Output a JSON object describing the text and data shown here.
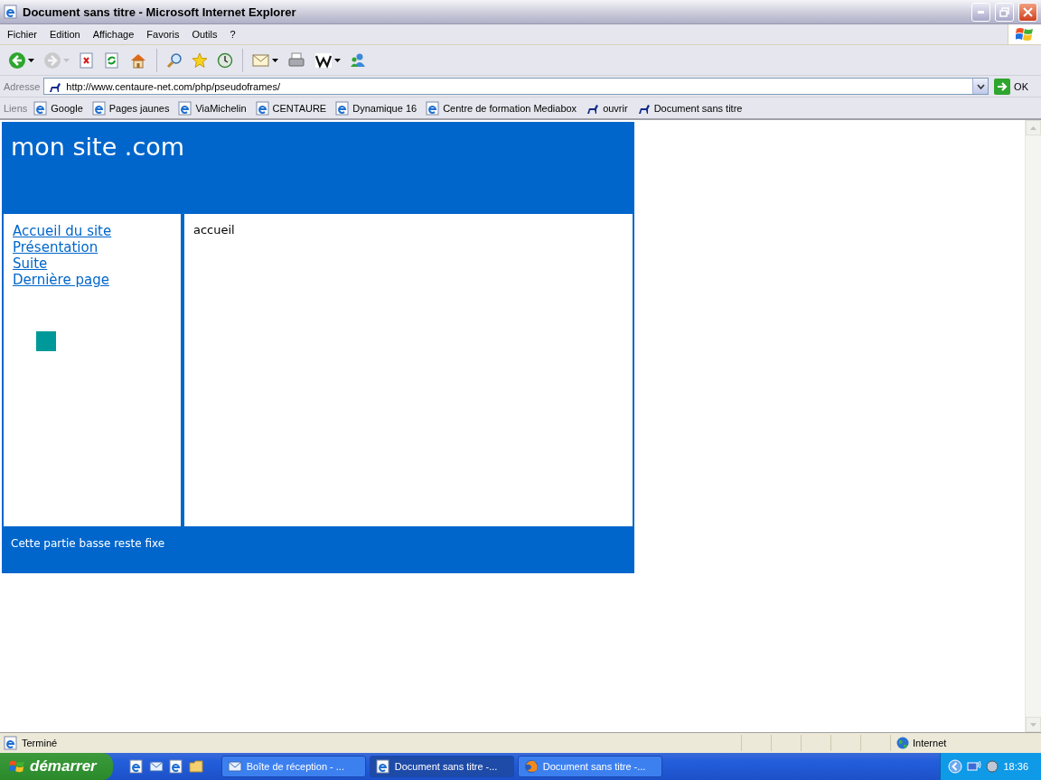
{
  "window": {
    "title": "Document sans titre - Microsoft Internet Explorer"
  },
  "menu": [
    "Fichier",
    "Edition",
    "Affichage",
    "Favoris",
    "Outils",
    "?"
  ],
  "toolbar": [
    {
      "kind": "back",
      "disabled": false,
      "dropdown": true
    },
    {
      "kind": "forward",
      "disabled": true,
      "dropdown": true
    },
    {
      "kind": "stop",
      "disabled": false,
      "dropdown": false
    },
    {
      "kind": "refresh",
      "disabled": false,
      "dropdown": false
    },
    {
      "kind": "home",
      "disabled": false,
      "dropdown": false
    },
    {
      "kind": "search",
      "disabled": false,
      "dropdown": false
    },
    {
      "kind": "favorites",
      "disabled": false,
      "dropdown": false
    },
    {
      "kind": "history",
      "disabled": false,
      "dropdown": false
    },
    {
      "kind": "mail",
      "disabled": false,
      "dropdown": true
    },
    {
      "kind": "print",
      "disabled": false,
      "dropdown": false
    },
    {
      "kind": "word",
      "disabled": false,
      "dropdown": true
    },
    {
      "kind": "messenger",
      "disabled": false,
      "dropdown": false
    }
  ],
  "address_bar": {
    "label": "Adresse",
    "value": "http://www.centaure-net.com/php/pseudoframes/",
    "go": "OK"
  },
  "links_bar": {
    "label": "Liens",
    "links": [
      {
        "label": "Google",
        "kind": "ie"
      },
      {
        "label": "Pages jaunes",
        "kind": "ie"
      },
      {
        "label": "ViaMichelin",
        "kind": "ie"
      },
      {
        "label": "CENTAURE",
        "kind": "ie"
      },
      {
        "label": "Dynamique 16",
        "kind": "ie"
      },
      {
        "label": "Centre de formation Mediabox",
        "kind": "ie"
      },
      {
        "label": "ouvrir",
        "kind": "site"
      },
      {
        "label": "Document sans titre",
        "kind": "site"
      }
    ]
  },
  "page": {
    "site_title": "mon site .com",
    "nav": [
      "Accueil du site",
      "Présentation",
      "Suite",
      "Dernière page"
    ],
    "main_text": "accueil",
    "footer_text": "Cette partie basse reste fixe"
  },
  "status_bar": {
    "text": "Terminé",
    "zone": "Internet"
  },
  "taskbar": {
    "start": "démarrer",
    "tasks": [
      {
        "label": "Boîte de réception - ...",
        "kind": "mail",
        "selected": false
      },
      {
        "label": "Document sans titre -...",
        "kind": "ie",
        "selected": true
      },
      {
        "label": "Document sans titre -...",
        "kind": "firefox",
        "selected": false
      }
    ],
    "clock": "18:36"
  }
}
